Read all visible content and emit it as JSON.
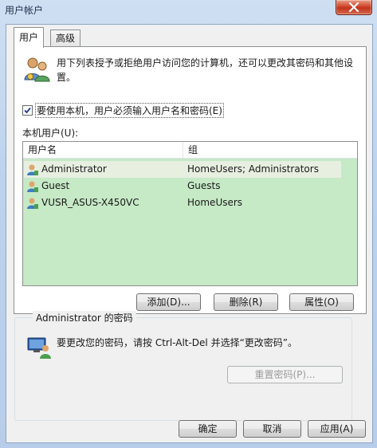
{
  "window": {
    "title": "用户帐户"
  },
  "tabs": [
    {
      "label": "用户"
    },
    {
      "label": "高级"
    }
  ],
  "users_tab": {
    "description": "用下列表授予或拒绝用户访问您的计算机，还可以更改其密码和其他设置。",
    "require_login_checkbox": {
      "label": "要使用本机，用户必须输入用户名和密码(E)",
      "checked": true
    },
    "local_users_label": "本机用户(U):",
    "columns": [
      "用户名",
      "组"
    ],
    "users": [
      {
        "name": "Administrator",
        "group": "HomeUsers; Administrators"
      },
      {
        "name": "Guest",
        "group": "Guests"
      },
      {
        "name": "VUSR_ASUS-X450VC",
        "group": "HomeUsers"
      }
    ],
    "buttons": {
      "add": "添加(D)...",
      "remove": "删除(R)",
      "properties": "属性(O)"
    }
  },
  "password_group": {
    "title": "Administrator 的密码",
    "instruction": "要更改您的密码，请按 Ctrl-Alt-Del 并选择“更改密码”。",
    "reset_button": "重置密码(P)..."
  },
  "dialog_buttons": {
    "ok": "确定",
    "cancel": "取消",
    "apply": "应用(A)"
  },
  "colors": {
    "list_background": "#c6e9c6",
    "title_gradient": "#bcd3ee",
    "close_red": "#c9422a"
  }
}
